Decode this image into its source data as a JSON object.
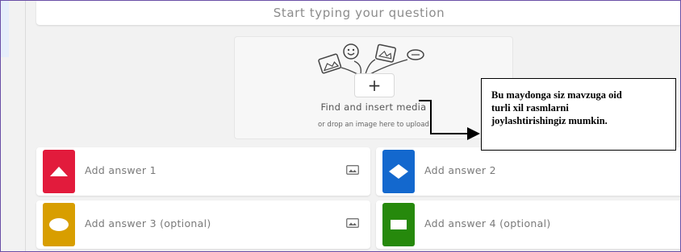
{
  "question": {
    "placeholder": "Start typing your question"
  },
  "media": {
    "add_label": "+",
    "title": "Find and insert media",
    "subtitle": "or drop an image here to upload"
  },
  "answers": [
    {
      "label": "Add answer 1",
      "color": "#e21b3c",
      "shape": "triangle-icon"
    },
    {
      "label": "Add answer 2",
      "color": "#1368ce",
      "shape": "diamond-icon"
    },
    {
      "label": "Add answer 3 (optional)",
      "color": "#d89e00",
      "shape": "circle-icon"
    },
    {
      "label": "Add answer 4 (optional)",
      "color": "#26890c",
      "shape": "square-icon"
    }
  ],
  "annotation": {
    "line1": "Bu maydonga siz mavzuga oid",
    "line2": "turli xil rasmlarni",
    "line3": "joylashtirishingiz mumkin."
  }
}
